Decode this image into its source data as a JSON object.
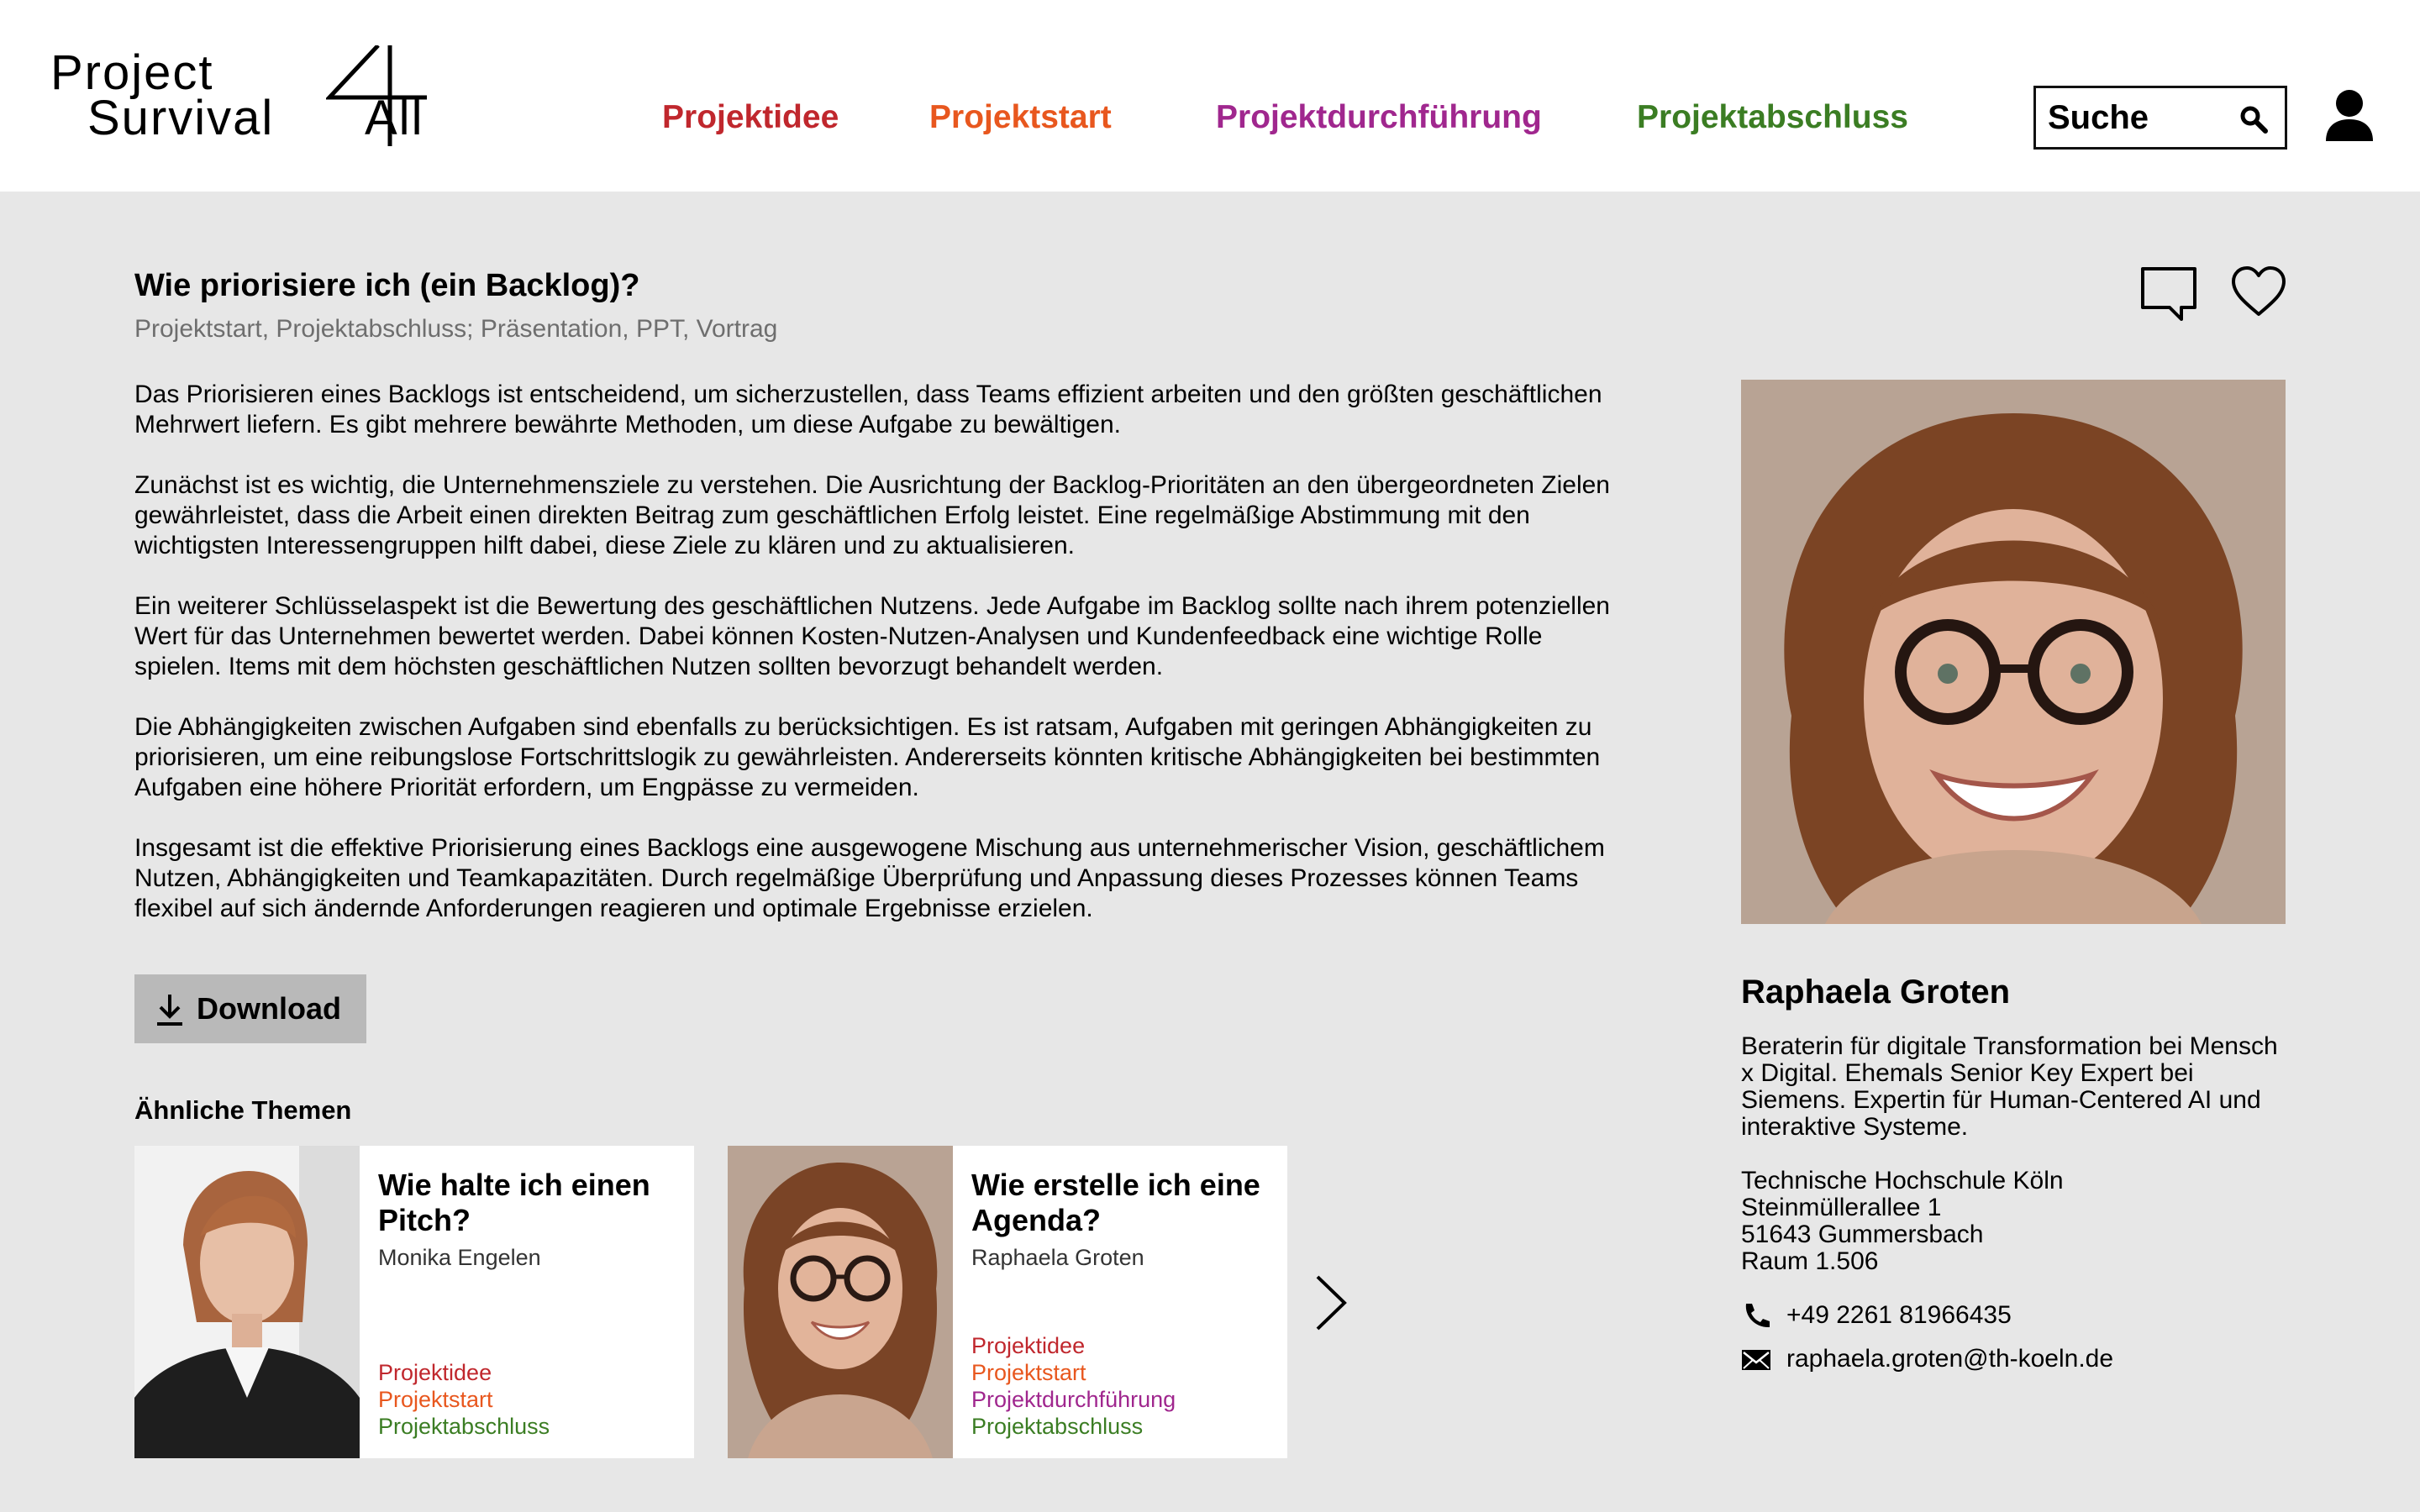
{
  "header": {
    "logo": {
      "line1": "Project",
      "line2": "Survival",
      "suffix": "All",
      "numeral": "4"
    },
    "nav": [
      {
        "label": "Projektidee",
        "color": "#c0272d"
      },
      {
        "label": "Projektstart",
        "color": "#e8571e"
      },
      {
        "label": "Projektdurchführung",
        "color": "#a0278e"
      },
      {
        "label": "Projektabschluss",
        "color": "#3b7d23"
      }
    ],
    "search": {
      "label": "Suche",
      "icon": "search-icon"
    },
    "user_icon": "user-icon"
  },
  "article": {
    "title": "Wie priorisiere ich (ein Backlog)?",
    "tags": "Projektstart, Projektabschluss; Präsentation, PPT, Vortrag",
    "paragraphs": [
      "Das Priorisieren eines Backlogs ist entscheidend, um sicherzustellen, dass Teams effizient arbeiten und den größten geschäftlichen Mehrwert liefern. Es gibt mehrere bewährte Methoden, um diese Aufgabe zu bewältigen.",
      "Zunächst ist es wichtig, die Unternehmensziele zu verstehen. Die Ausrichtung der Backlog-Prioritäten an den übergeordneten Zielen gewährleistet, dass die Arbeit einen direkten Beitrag zum geschäftlichen Erfolg leistet. Eine regelmäßige Abstimmung mit den wichtigsten Interessengruppen hilft dabei, diese Ziele zu klären und zu aktualisieren.",
      "Ein weiterer Schlüsselaspekt ist die Bewertung des geschäftlichen Nutzens. Jede Aufgabe im Backlog sollte nach ihrem potenziellen Wert für das Unternehmen bewertet werden. Dabei können Kosten-Nutzen-Analysen und Kundenfeedback eine wichtige Rolle spielen. Items mit dem höchsten geschäftlichen Nutzen sollten bevorzugt behandelt werden.",
      "Die Abhängigkeiten zwischen Aufgaben sind ebenfalls zu berücksichtigen. Es ist ratsam, Aufgaben mit geringen Abhängigkeiten zu priorisieren, um eine reibungslose Fortschrittslogik zu gewährleisten. Andererseits könnten kritische Abhängigkeiten bei bestimmten Aufgaben eine höhere Priorität erfordern, um Engpässe zu vermeiden.",
      "Insgesamt ist die effektive Priorisierung eines Backlogs eine ausgewogene Mischung aus unternehmerischer Vision, geschäftlichem Nutzen, Abhängigkeiten und Teamkapazitäten. Durch regelmäßige Überprüfung und Anpassung dieses Prozesses können Teams flexibel auf sich ändernde Anforderungen reagieren und optimale Ergebnisse erzielen."
    ],
    "download_label": "Download",
    "actions": {
      "comment_icon": "comment-icon",
      "like_icon": "heart-icon"
    }
  },
  "similar": {
    "heading": "Ähnliche Themen",
    "cards": [
      {
        "title": "Wie halte ich einen Pitch?",
        "author": "Monika Engelen",
        "tags": [
          "Projektidee",
          "Projektstart",
          "Projektabschluss"
        ]
      },
      {
        "title": "Wie erstelle ich eine Agenda?",
        "author": "Raphaela Groten",
        "tags": [
          "Projektidee",
          "Projektstart",
          "Projektdurchführung",
          "Projektabschluss"
        ]
      }
    ],
    "next_icon": "chevron-right-icon"
  },
  "person": {
    "name": "Raphaela Groten",
    "bio": "Beraterin für digitale Transformation bei Mensch x Digital. Ehemals Senior Key Expert bei Siemens. Expertin für Human-Centered AI und interaktive Systeme.",
    "address": [
      "Technische Hochschule Köln",
      "Steinmüllerallee 1",
      "51643 Gummersbach",
      "Raum 1.506"
    ],
    "phone": "+49 2261 81966435",
    "email": "raphaela.groten@th-koeln.de"
  },
  "colors": {
    "projektidee": "#c0272d",
    "projektstart": "#e8571e",
    "projektdurchfuehrung": "#a0278e",
    "projektabschluss": "#3b7d23",
    "page_background": "#e7e7e7"
  }
}
